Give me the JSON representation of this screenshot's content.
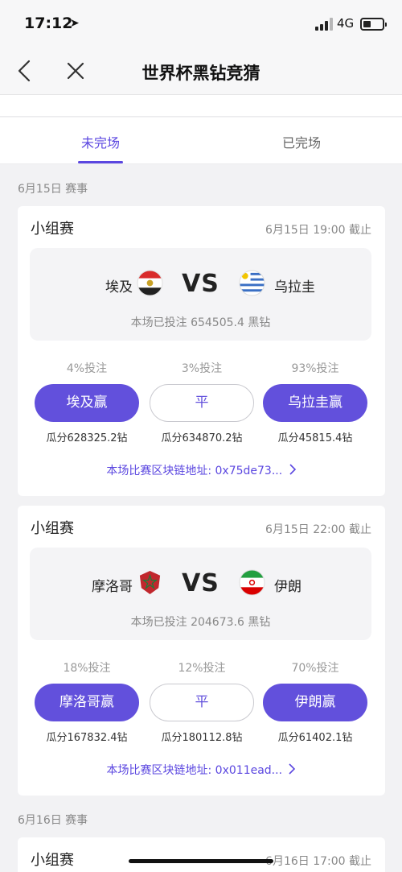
{
  "status_bar": {
    "time": "17:12",
    "network": "4G"
  },
  "nav": {
    "title": "世界杯黑钻竞猜"
  },
  "tabs": [
    {
      "label": "未完场",
      "active": true
    },
    {
      "label": "已完场",
      "active": false
    }
  ],
  "accent_color": "#5b47e0",
  "sections": [
    {
      "date_label": "6月15日  赛事",
      "matches": [
        {
          "stage": "小组赛",
          "deadline": "6月15日 19:00 截止",
          "home_team": "埃及",
          "away_team": "乌拉圭",
          "vs": "VS",
          "total_bets": "本场已投注 654505.4 黑钻",
          "options": [
            {
              "pct": "4%投注",
              "label": "埃及赢",
              "payout": "瓜分628325.2钻",
              "style": "primary"
            },
            {
              "pct": "3%投注",
              "label": "平",
              "payout": "瓜分634870.2钻",
              "style": "outline"
            },
            {
              "pct": "93%投注",
              "label": "乌拉圭赢",
              "payout": "瓜分45815.4钻",
              "style": "primary"
            }
          ],
          "chain_link": "本场比赛区块链地址: 0x75de73..."
        },
        {
          "stage": "小组赛",
          "deadline": "6月15日 22:00 截止",
          "home_team": "摩洛哥",
          "away_team": "伊朗",
          "vs": "VS",
          "total_bets": "本场已投注 204673.6 黑钻",
          "options": [
            {
              "pct": "18%投注",
              "label": "摩洛哥赢",
              "payout": "瓜分167832.4钻",
              "style": "primary"
            },
            {
              "pct": "12%投注",
              "label": "平",
              "payout": "瓜分180112.8钻",
              "style": "outline"
            },
            {
              "pct": "70%投注",
              "label": "伊朗赢",
              "payout": "瓜分61402.1钻",
              "style": "primary"
            }
          ],
          "chain_link": "本场比赛区块链地址: 0x011ead..."
        }
      ]
    },
    {
      "date_label": "6月16日  赛事",
      "matches": [
        {
          "stage": "小组赛",
          "deadline": "6月16日 17:00 截止"
        }
      ]
    }
  ]
}
